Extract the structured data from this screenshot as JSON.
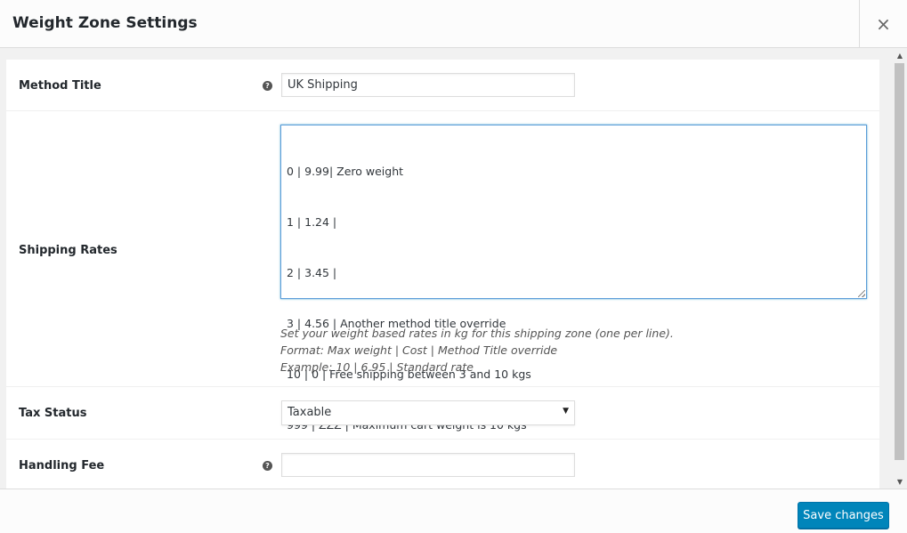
{
  "modal": {
    "title": "Weight Zone Settings",
    "close_label": "×"
  },
  "fields": {
    "method_title": {
      "label": "Method Title",
      "value": "UK Shipping",
      "help_icon": "question-circle-icon"
    },
    "shipping_rates": {
      "label": "Shipping Rates",
      "lines": [
        "0 | 9.99| Zero weight",
        "1 | 1.24 |",
        "2 | 3.45 |",
        "3 | 4.56 | Another method title override",
        "10 | 0 | Free shipping between 3 and 10 kgs",
        "999 | ZZZ | Maximum cart weight is 10 kgs"
      ],
      "description": [
        "Set your weight based rates in kg for this shipping zone (one per line).",
        "Format: Max weight | Cost | Method Title override",
        "Example: 10 | 6.95 | Standard rate"
      ]
    },
    "tax_status": {
      "label": "Tax Status",
      "selected": "Taxable"
    },
    "handling_fee": {
      "label": "Handling Fee",
      "value": "",
      "help_icon": "question-circle-icon"
    }
  },
  "footer": {
    "save_label": "Save changes"
  },
  "colors": {
    "primary_button": "#0085ba",
    "focus_border": "#5b9dd9"
  }
}
